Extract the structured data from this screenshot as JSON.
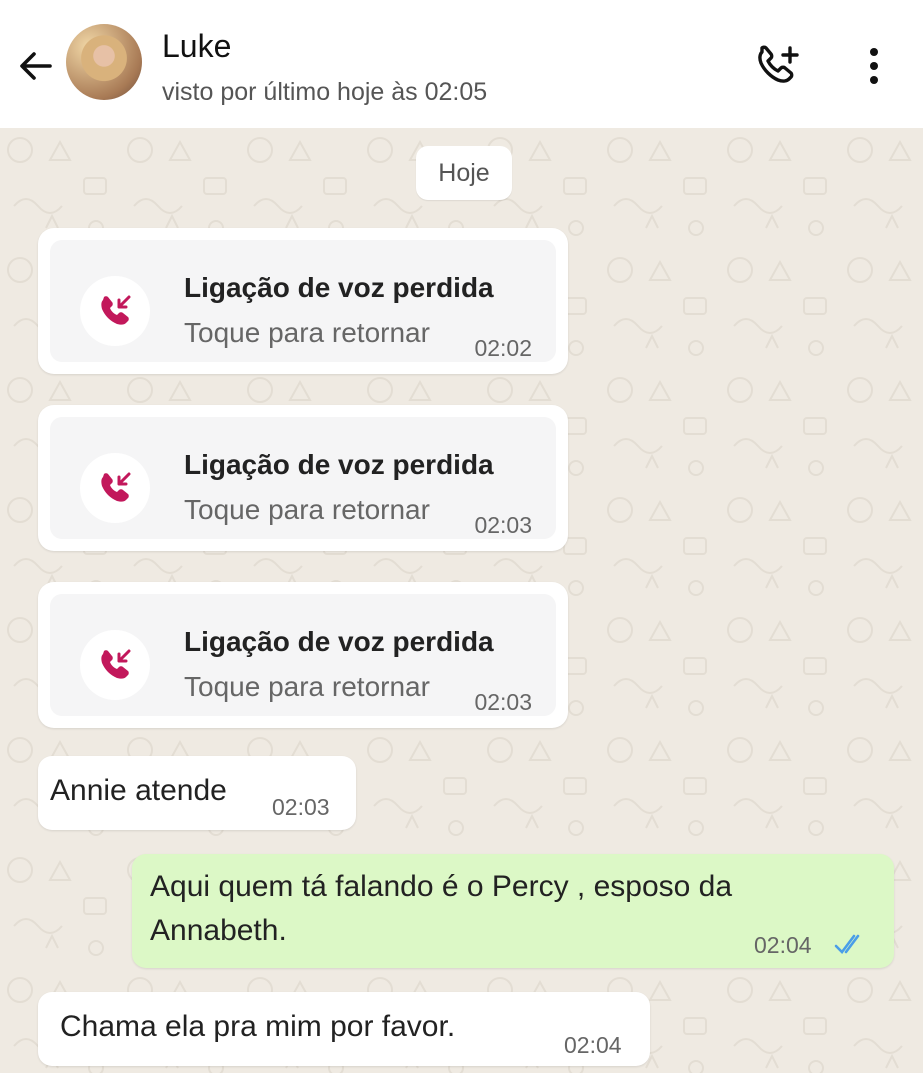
{
  "header": {
    "contact_name": "Luke",
    "last_seen": "visto por último hoje às 02:05"
  },
  "icons": {
    "back": "arrow-left",
    "add_call": "phone-plus",
    "menu": "more-vertical",
    "missed_call": "phone-missed"
  },
  "colors": {
    "missed_call": "#c2185b",
    "read_ticks": "#4a9ee8",
    "outgoing_bubble": "#dcf8c6"
  },
  "chat": {
    "date_separator": "Hoje",
    "missed_calls": [
      {
        "title": "Ligação de voz perdida",
        "subtitle": "Toque para retornar",
        "time": "02:02"
      },
      {
        "title": "Ligação de voz perdida",
        "subtitle": "Toque para retornar",
        "time": "02:03"
      },
      {
        "title": "Ligação de voz perdida",
        "subtitle": "Toque para retornar",
        "time": "02:03"
      }
    ],
    "messages": [
      {
        "direction": "incoming",
        "text": "Annie atende",
        "time": "02:03"
      },
      {
        "direction": "outgoing",
        "text_line1": "Aqui quem tá falando é o Percy  , esposo da",
        "text_line2": "Annabeth.",
        "time": "02:04",
        "status": "read"
      },
      {
        "direction": "incoming",
        "text": "Chama ela pra mim por favor.",
        "time": "02:04"
      }
    ]
  }
}
